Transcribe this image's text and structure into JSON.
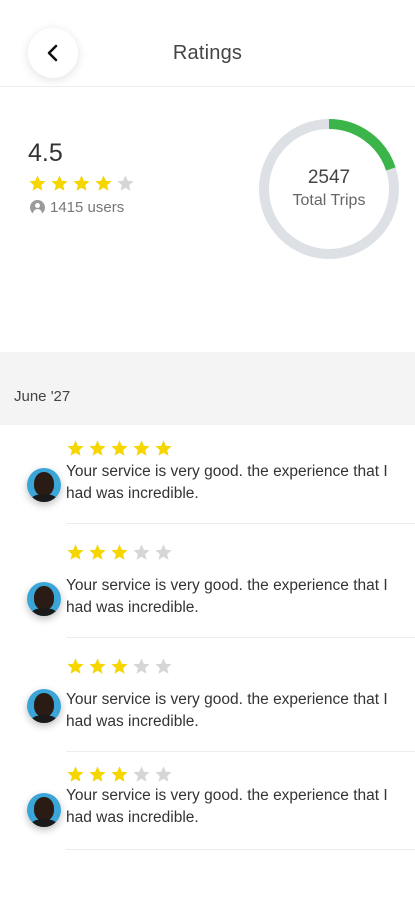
{
  "header": {
    "title": "Ratings",
    "back_icon": "chevron-left-icon"
  },
  "summary": {
    "rating": "4.5",
    "stars": [
      1,
      1,
      1,
      1,
      0
    ],
    "users_text": "1415 users",
    "trips_count": "2547",
    "trips_label": "Total Trips",
    "donut_fraction": 0.2,
    "colors": {
      "accent": "#3bb54a",
      "track": "#dde1e5",
      "star": "#f5d600",
      "star_off": "#d6d6d6"
    }
  },
  "month": "June '27",
  "reviews": [
    {
      "stars": [
        1,
        1,
        1,
        1,
        1
      ],
      "text": "Your service is very good. the experience that I had was incredible."
    },
    {
      "stars": [
        1,
        1,
        1,
        0,
        0
      ],
      "text": "Your service is very good. the experience that I had was incredible."
    },
    {
      "stars": [
        1,
        1,
        1,
        0,
        0
      ],
      "text": "Your service is very good. the experience that I had was incredible."
    },
    {
      "stars": [
        1,
        1,
        1,
        0,
        0
      ],
      "text": "Your service is very good. the experience that I had was incredible."
    }
  ]
}
